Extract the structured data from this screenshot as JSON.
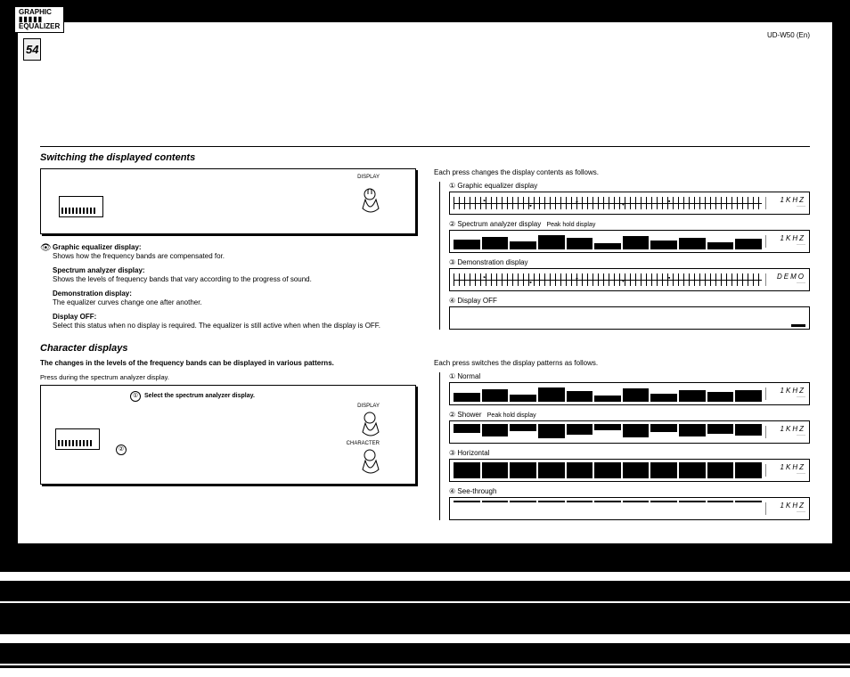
{
  "header": {
    "badge_line1": "GRAPHIC",
    "badge_line2": "EQUALIZER",
    "model": "UD-W50 (En)",
    "page_number": "54"
  },
  "section1": {
    "title": "Switching the displayed contents",
    "button_label": "DISPLAY",
    "defs": [
      {
        "title": "Graphic equalizer display:",
        "body": "Shows how the frequency bands are compensated for.",
        "icon": true
      },
      {
        "title": "Spectrum analyzer display:",
        "body": "Shows the levels of frequency bands that vary according to the progress of sound."
      },
      {
        "title": "Demonstration display:",
        "body": "The equalizer curves change one after another."
      },
      {
        "title": "Display OFF:",
        "body": "Select this status when no display is required. The equalizer is still active when when the display is OFF."
      }
    ],
    "right_intro": "Each press changes the display contents as follows.",
    "displays": [
      {
        "num": "①",
        "label": "Graphic equalizer display",
        "readout": "1KHZ",
        "kind": "curve"
      },
      {
        "num": "②",
        "label": "Spectrum analyzer display",
        "callout": "Peak hold display",
        "readout": "1KHZ",
        "kind": "bars"
      },
      {
        "num": "③",
        "label": "Demonstration display",
        "readout": "DEMO",
        "kind": "curve"
      },
      {
        "num": "④",
        "label": "Display OFF",
        "readout": "",
        "kind": "empty"
      }
    ]
  },
  "section2": {
    "title": "Character displays",
    "subhead": "The changes in the levels of the frequency bands can be displayed in various patterns.",
    "note": "Press during the spectrum analyzer display.",
    "step1_num": "①",
    "step1": "Select the spectrum analyzer display.",
    "step_display": "DISPLAY",
    "step2_num": "②",
    "step_character": "CHARACTER",
    "right_intro": "Each press switches the display patterns as follows.",
    "displays": [
      {
        "num": "①",
        "label": "Normal",
        "readout": "1KHZ",
        "kind": "bars"
      },
      {
        "num": "②",
        "label": "Shower",
        "callout": "Peak hold display",
        "readout": "1KHZ",
        "kind": "shower"
      },
      {
        "num": "③",
        "label": "Horizontal",
        "readout": "1KHZ",
        "kind": "horizontal"
      },
      {
        "num": "④",
        "label": "See-through",
        "readout": "1KHZ",
        "kind": "see"
      }
    ]
  }
}
